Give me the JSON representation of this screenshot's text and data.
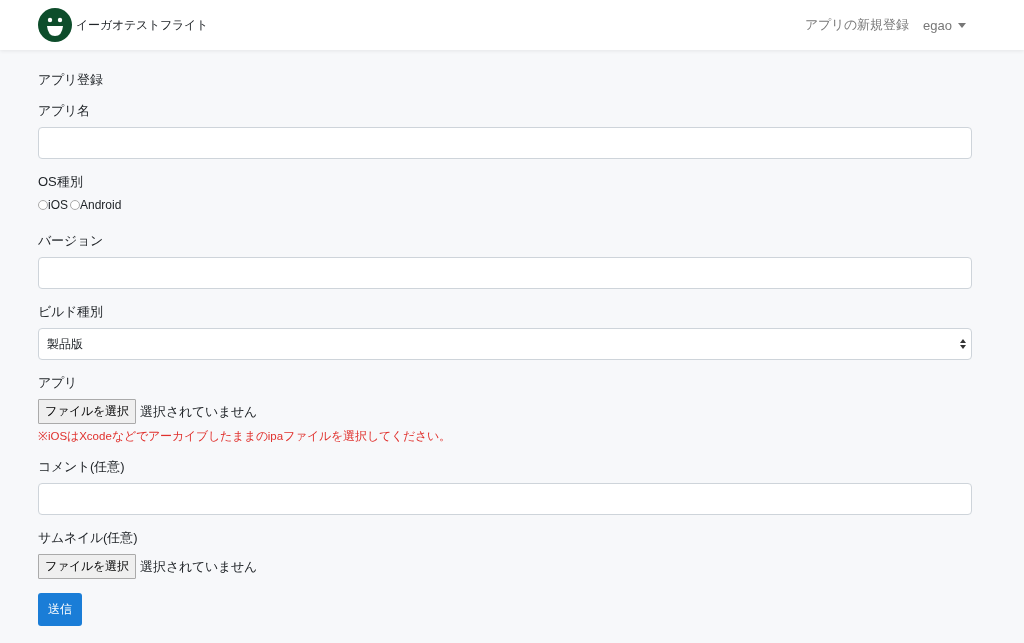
{
  "navbar": {
    "brand": "イーガオテストフライト",
    "links": [
      {
        "label": "アプリの新規登録",
        "kind": "link"
      },
      {
        "label": "egao",
        "kind": "dropdown"
      }
    ]
  },
  "form": {
    "title": "アプリ登録",
    "fields": [
      {
        "kind": "text",
        "label": "アプリ名"
      },
      {
        "kind": "radio",
        "label": "OS種別",
        "options": [
          {
            "label": "iOS",
            "selected": false
          },
          {
            "label": "Android",
            "selected": false
          }
        ]
      },
      {
        "kind": "text",
        "label": "バージョン"
      },
      {
        "kind": "select",
        "label": "ビルド種別",
        "value": "製品版"
      },
      {
        "kind": "file",
        "label": "アプリ",
        "button": "ファイルを選択",
        "status": "選択されていません",
        "note": "※iOSはXcodeなどでアーカイブしたままのipaファイルを選択してください。"
      },
      {
        "kind": "text",
        "label": "コメント(任意)"
      },
      {
        "kind": "file",
        "label": "サムネイル(任意)",
        "button": "ファイルを選択",
        "status": "選択されていません"
      }
    ],
    "submit": "送信"
  }
}
